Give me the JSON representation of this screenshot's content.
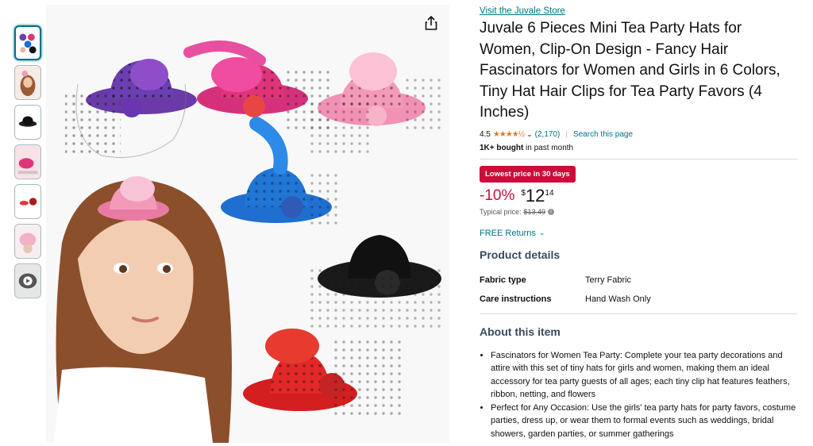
{
  "thumbnails": [
    {
      "name": "hats-group",
      "active": true
    },
    {
      "name": "girl-with-hat",
      "active": false
    },
    {
      "name": "black-hat",
      "active": false
    },
    {
      "name": "pink-hat-model",
      "active": false
    },
    {
      "name": "red-hat-small",
      "active": false
    },
    {
      "name": "pink-hat-closeup",
      "active": false
    },
    {
      "name": "video-thumb",
      "active": false
    }
  ],
  "product": {
    "store_link": "Visit the Juvale Store",
    "title": "Juvale 6 Pieces Mini Tea Party Hats for Women, Clip-On Design - Fancy Hair Fascinators for Women and Girls in 6 Colors, Tiny Hat Hair Clips for Tea Party Favors (4 Inches)",
    "rating": "4.5",
    "stars": "★★★★½",
    "rating_count": "(2,170)",
    "search_page": "Search this page",
    "bought_bold": "1K+ bought",
    "bought_rest": " in past month",
    "deal_badge": "Lowest price in 30 days",
    "discount": "-10%",
    "price_symbol": "$",
    "price_whole": "12",
    "price_fraction": "14",
    "typical_label": "Typical price:",
    "typical_price": "$13.49",
    "returns": "FREE Returns"
  },
  "details": {
    "title": "Product details",
    "rows": [
      {
        "key": "Fabric type",
        "value": "Terry Fabric"
      },
      {
        "key": "Care instructions",
        "value": "Hand Wash Only"
      }
    ]
  },
  "about": {
    "title": "About this item",
    "bullets": [
      "Fascinators for Women Tea Party: Complete your tea party decorations and attire with this set of tiny hats for girls and women, making them an ideal accessory for tea party guests of all ages; each tiny clip hat features feathers, ribbon, netting, and flowers",
      "Perfect for Any Occasion: Use the girls' tea party hats for party favors, costume parties, dress up, or wear them to formal events such as weddings, bridal showers, garden parties, or summer gatherings"
    ]
  },
  "colors": {
    "link": "#007185",
    "deal": "#cc0c39",
    "star": "#de7921"
  }
}
